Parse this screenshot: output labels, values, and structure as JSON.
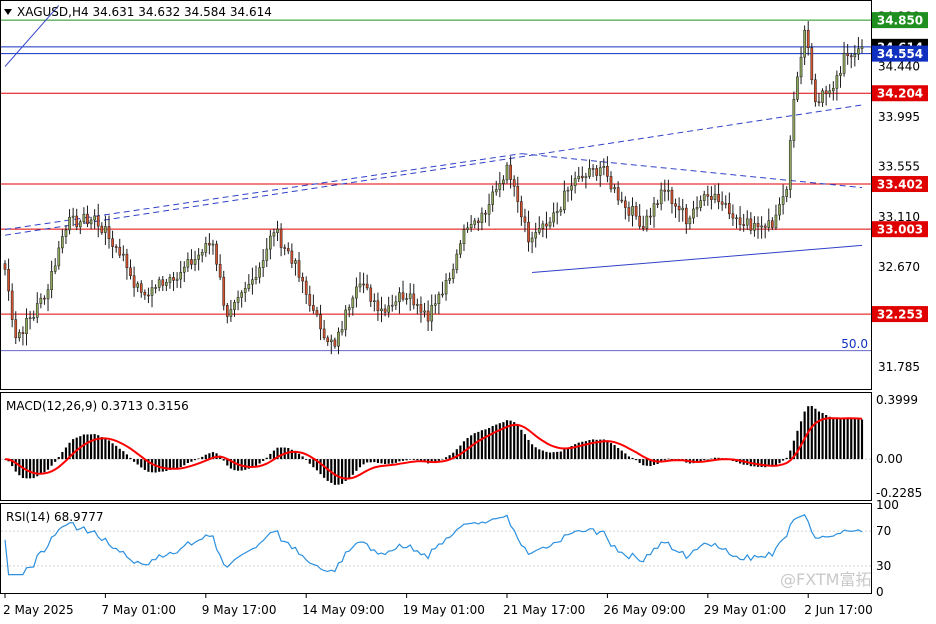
{
  "header": {
    "symbol_line": "XAGUSD,H4  34.631 34.632 34.584 34.614",
    "triangle_icon": "triangle-down-icon"
  },
  "watermark": "@FXTM富拓",
  "colors": {
    "bull": "#8da65a",
    "bear": "#d3512d",
    "wick": "#1a1a1a",
    "support_resistance": "#e00000",
    "green_line": "#1f8f1f",
    "blue_line": "#1030c0",
    "dashed_line": "#3040c8",
    "macd_hist": "#000000",
    "macd_signal": "#ff0000",
    "rsi": "#2a8fdf",
    "red_label_bg": "#e00000",
    "green_label_bg": "#1f8f1f",
    "blue_label_bg": "#1030c0",
    "black_label_bg": "#000000"
  },
  "price_axis": {
    "ticks": [
      "34.880",
      "34.440",
      "33.995",
      "33.555",
      "33.110",
      "32.670",
      "32.225",
      "31.785"
    ],
    "tick_values": [
      34.88,
      34.44,
      33.995,
      33.555,
      33.11,
      32.67,
      32.225,
      31.785
    ],
    "ylim": [
      31.6,
      35.01
    ]
  },
  "levels": [
    {
      "name": "level-34850",
      "label": "34.850",
      "value": 34.85,
      "color_key": "green_line",
      "bg_key": "green_label_bg"
    },
    {
      "name": "level-34614",
      "label": "34.614",
      "value": 34.614,
      "color_key": "blue_line",
      "bg_key": "black_label_bg"
    },
    {
      "name": "level-34554",
      "label": "34.554",
      "value": 34.554,
      "color_key": "blue_line",
      "bg_key": "blue_label_bg"
    },
    {
      "name": "level-34204",
      "label": "34.204",
      "value": 34.204,
      "color_key": "support_resistance",
      "bg_key": "red_label_bg"
    },
    {
      "name": "level-33402",
      "label": "33.402",
      "value": 33.402,
      "color_key": "support_resistance",
      "bg_key": "red_label_bg"
    },
    {
      "name": "level-33003",
      "label": "33.003",
      "value": 33.003,
      "color_key": "support_resistance",
      "bg_key": "red_label_bg"
    },
    {
      "name": "level-32253",
      "label": "32.253",
      "value": 32.253,
      "color_key": "support_resistance",
      "bg_key": "red_label_bg"
    }
  ],
  "fib_label": "50.0",
  "fib_value": 31.93,
  "time_axis": {
    "labels": [
      "2 May 2025",
      "7 May 01:00",
      "9 May 17:00",
      "14 May 09:00",
      "19 May 01:00",
      "21 May 17:00",
      "26 May 09:00",
      "29 May 01:00",
      "2 Jun 17:00"
    ],
    "label_bars": [
      0,
      28,
      56,
      84,
      112,
      140,
      168,
      196,
      224
    ]
  },
  "macd": {
    "label": "MACD(12,26,9) 0.3713 0.3156",
    "ticks": [
      "0.3999",
      "0.00",
      "-0.2285"
    ],
    "tick_values": [
      0.3999,
      0.0,
      -0.2285
    ],
    "ylim": [
      -0.27,
      0.44
    ]
  },
  "rsi": {
    "label": "RSI(14) 68.9777",
    "ticks": [
      "100",
      "70",
      "30",
      "0"
    ],
    "tick_values": [
      100,
      70,
      30,
      0
    ],
    "ylim": [
      0,
      100
    ]
  },
  "chart_data": {
    "type": "candlestick",
    "title": "XAGUSD,H4",
    "bar_count": 240,
    "ohlc_ref": {
      "open": 34.631,
      "high": 34.632,
      "low": 34.584,
      "close": 34.614
    },
    "anchors": [
      {
        "bar": 0,
        "price": 32.65
      },
      {
        "bar": 3,
        "price": 32.05
      },
      {
        "bar": 8,
        "price": 32.25
      },
      {
        "bar": 12,
        "price": 32.5
      },
      {
        "bar": 17,
        "price": 33.05
      },
      {
        "bar": 25,
        "price": 33.1
      },
      {
        "bar": 33,
        "price": 32.75
      },
      {
        "bar": 38,
        "price": 32.4
      },
      {
        "bar": 44,
        "price": 32.55
      },
      {
        "bar": 50,
        "price": 32.65
      },
      {
        "bar": 58,
        "price": 32.9
      },
      {
        "bar": 62,
        "price": 32.2
      },
      {
        "bar": 70,
        "price": 32.6
      },
      {
        "bar": 75,
        "price": 33.0
      },
      {
        "bar": 80,
        "price": 32.75
      },
      {
        "bar": 86,
        "price": 32.25
      },
      {
        "bar": 92,
        "price": 31.95
      },
      {
        "bar": 98,
        "price": 32.55
      },
      {
        "bar": 105,
        "price": 32.3
      },
      {
        "bar": 112,
        "price": 32.45
      },
      {
        "bar": 118,
        "price": 32.25
      },
      {
        "bar": 124,
        "price": 32.55
      },
      {
        "bar": 128,
        "price": 33.05
      },
      {
        "bar": 134,
        "price": 33.15
      },
      {
        "bar": 140,
        "price": 33.55
      },
      {
        "bar": 146,
        "price": 32.9
      },
      {
        "bar": 152,
        "price": 33.05
      },
      {
        "bar": 158,
        "price": 33.4
      },
      {
        "bar": 166,
        "price": 33.55
      },
      {
        "bar": 172,
        "price": 33.25
      },
      {
        "bar": 178,
        "price": 33.05
      },
      {
        "bar": 184,
        "price": 33.35
      },
      {
        "bar": 190,
        "price": 33.1
      },
      {
        "bar": 196,
        "price": 33.35
      },
      {
        "bar": 202,
        "price": 33.15
      },
      {
        "bar": 208,
        "price": 33.05
      },
      {
        "bar": 214,
        "price": 33.05
      },
      {
        "bar": 218,
        "price": 33.3
      },
      {
        "bar": 220,
        "price": 34.2
      },
      {
        "bar": 223,
        "price": 34.75
      },
      {
        "bar": 226,
        "price": 34.15
      },
      {
        "bar": 230,
        "price": 34.2
      },
      {
        "bar": 234,
        "price": 34.5
      },
      {
        "bar": 239,
        "price": 34.614
      }
    ],
    "trendlines": [
      {
        "name": "channel-upper-dashed",
        "points": [
          [
            0,
            33.0
          ],
          [
            144,
            33.67
          ]
        ],
        "style": "dashed"
      },
      {
        "name": "triangle-upper-dashed",
        "points": [
          [
            144,
            33.67
          ],
          [
            239,
            33.37
          ]
        ],
        "style": "dashed"
      },
      {
        "name": "triangle-lower",
        "points": [
          [
            147,
            32.62
          ],
          [
            239,
            32.86
          ]
        ],
        "style": "solid"
      },
      {
        "name": "breakout-dashed",
        "points": [
          [
            0,
            32.95
          ],
          [
            239,
            34.1
          ]
        ],
        "style": "dashed"
      },
      {
        "name": "top-left-diagonal",
        "points": [
          [
            0,
            34.44
          ],
          [
            15,
            34.98
          ]
        ],
        "style": "solid"
      }
    ]
  }
}
